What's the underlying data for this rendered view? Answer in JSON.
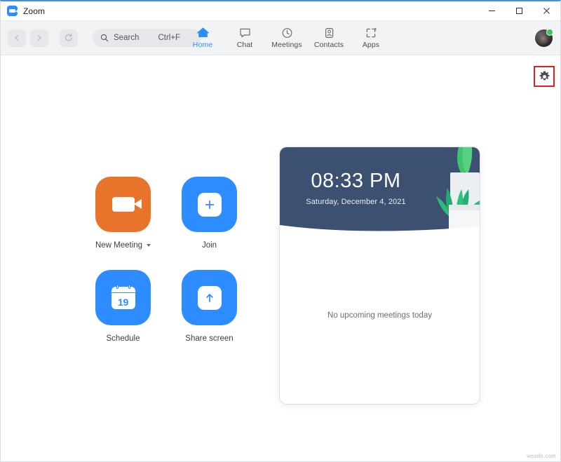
{
  "window": {
    "title": "Zoom",
    "logo_icon": "zoom-camera-logo",
    "controls": {
      "minimize": "minimize-icon",
      "maximize": "maximize-icon",
      "close": "close-icon"
    }
  },
  "toolbar": {
    "back_icon": "chevron-left-icon",
    "forward_icon": "chevron-right-icon",
    "refresh_icon": "refresh-icon",
    "search": {
      "icon": "search-icon",
      "placeholder": "Search",
      "shortcut": "Ctrl+F"
    },
    "avatar": {
      "name": "user-avatar",
      "status": "online",
      "status_color": "#34c759"
    }
  },
  "nav": {
    "items": [
      {
        "label": "Home",
        "icon": "home-icon",
        "active": true
      },
      {
        "label": "Chat",
        "icon": "chat-bubble-icon",
        "active": false
      },
      {
        "label": "Meetings",
        "icon": "clock-icon",
        "active": false
      },
      {
        "label": "Contacts",
        "icon": "contact-card-icon",
        "active": false
      },
      {
        "label": "Apps",
        "icon": "apps-grid-icon",
        "active": false
      }
    ],
    "active_color": "#2d8cff",
    "inactive_color": "#4a4d52"
  },
  "settings": {
    "icon": "gear-icon",
    "highlight_color": "#e02020",
    "highlighted": true
  },
  "actions": [
    {
      "label": "New Meeting",
      "icon": "video-camera-icon",
      "tile_color": "#e8742c",
      "has_dropdown": true
    },
    {
      "label": "Join",
      "icon": "plus-square-icon",
      "tile_color": "#2d8cff",
      "has_dropdown": false
    },
    {
      "label": "Schedule",
      "icon": "calendar-icon",
      "tile_color": "#2d8cff",
      "has_dropdown": false,
      "calendar_day": "19"
    },
    {
      "label": "Share screen",
      "icon": "share-screen-arrow-icon",
      "tile_color": "#2d8cff",
      "has_dropdown": false
    }
  ],
  "meeting_card": {
    "banner_color": "#3c5071",
    "time": "08:33 PM",
    "date": "Saturday, December 4, 2021",
    "illustration": "potted-plant-illustration",
    "empty_message": "No upcoming meetings today"
  },
  "watermark": "wsxdn.com"
}
